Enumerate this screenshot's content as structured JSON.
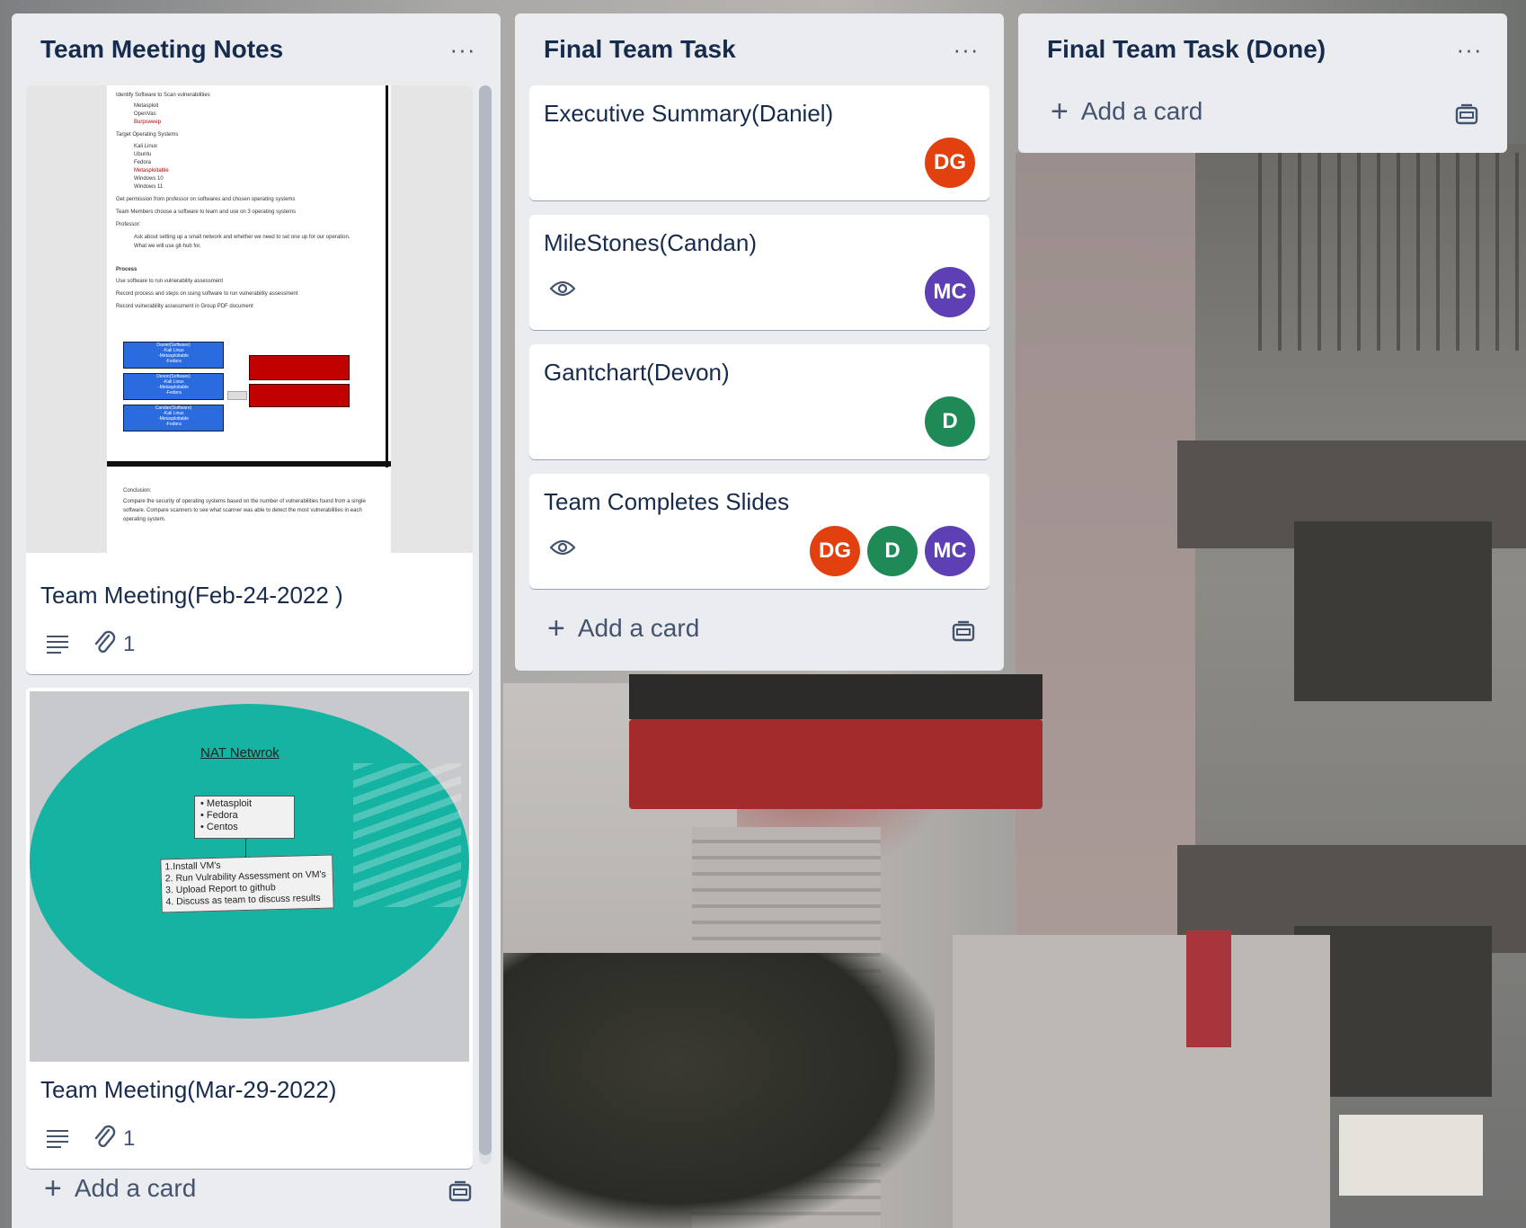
{
  "lists": [
    {
      "title": "Team Meeting Notes",
      "more_label": "···",
      "cards": [
        {
          "title": "Team Meeting(Feb-24-2022 )",
          "attachment_count": "1",
          "cover_doc": {
            "lines": [
              "Identify Software to Scan vulnerabilities",
              "Metasploit",
              "OpenVas",
              "Burpsweep",
              "Target Operating Systems",
              "Kali Linux",
              "Ubuntu",
              "Fedora",
              "Metasploitable",
              "Windows 10",
              "Windows 11",
              "Get permission from professor on softwares and chosen operating systems",
              "Team Members choose a software to learn and use on 3 operating systems",
              "Professor:",
              "Ask about setting up a small network and whether we need to set one up for our operation.",
              "What we will use git-hub for.",
              "Process",
              "Use software to run vulnerability assessment",
              "Record process and steps on using software to run vulnerability assessment",
              "Record vulnerability assessment in Group PDF document",
              "Conclusion:",
              "Compare the security of operating systems based on the number of vulnerabilities found from a single",
              "software. Compare scanners to see what scanner was able to detect the most vulnerabilities in each",
              "operating system."
            ],
            "boxes": [
              "Daniel(Software)\n-Kali Linux\n-Metasploitable\n-Fedora",
              "Devon(Software)\n-Kali Linux\n-Metasploitable\n-Fedora",
              "Candan(Software)\n-Kali Linux\n-Metasploitable\n-Fedora"
            ]
          }
        },
        {
          "title": "Team Meeting(Mar-29-2022)",
          "attachment_count": "1",
          "cover_nat": {
            "heading": "NAT Netwrok",
            "box1": [
              "• Metasploit",
              "• Fedora",
              "• Centos"
            ],
            "box2": [
              "1.Install VM's",
              "2. Run Vulrability Assessment on VM's",
              "3. Upload Report to github",
              "4. Discuss as team to discuss results"
            ]
          }
        }
      ],
      "add_card_label": "Add a card"
    },
    {
      "title": "Final Team Task",
      "more_label": "···",
      "cards": [
        {
          "title": "Executive Summary(Daniel)",
          "members": [
            "DG"
          ]
        },
        {
          "title": "MileStones(Candan)",
          "members": [
            "MC"
          ]
        },
        {
          "title": "Gantchart(Devon)",
          "members": [
            "D"
          ]
        },
        {
          "title": "Team Completes Slides",
          "members": [
            "DG",
            "D",
            "MC"
          ]
        }
      ],
      "add_card_label": "Add a card"
    },
    {
      "title": "Final Team Task (Done)",
      "more_label": "···",
      "add_card_label": "Add a card"
    }
  ],
  "member_colors": {
    "DG": "#e2410f",
    "MC": "#5e3fb4",
    "D": "#1f8a55"
  },
  "icons": {
    "more": "ellipsis-icon",
    "description": "description-icon",
    "attachment": "paperclip-icon",
    "watch": "eye-icon",
    "add": "plus-icon",
    "template": "card-template-icon"
  }
}
